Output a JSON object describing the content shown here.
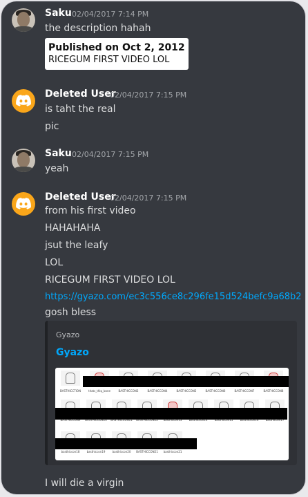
{
  "messages": [
    {
      "user": "Saku",
      "timestamp": "02/04/2017 7:14 PM",
      "lines": [
        "the description hahah"
      ],
      "quote_image": {
        "line1": "Published on Oct 2, 2012",
        "line2": "RICEGUM FIRST VIDEO LOL"
      }
    },
    {
      "user": "Deleted User",
      "timestamp": "02/04/2017 7:15 PM",
      "lines": [
        "is taht the real",
        "pic"
      ]
    },
    {
      "user": "Saku",
      "timestamp": "02/04/2017 7:15 PM",
      "lines": [
        "yeah"
      ]
    },
    {
      "user": "Deleted User",
      "timestamp": "02/04/2017 7:15 PM",
      "lines": [
        "from his first video",
        "HAHAHAHA",
        "jsut the leafy",
        "LOL",
        "RICEGUM FIRST VIDEO LOL"
      ],
      "link": "https://gyazo.com/ec3c556ce8c296fe15d524befc9a68b2",
      "after_link": "gosh bless",
      "embed": {
        "provider": "Gyazo",
        "title": "Gyazo",
        "thumb_captions": {
          "row1": [
            "BASTHICCTION",
            "thats_thiq_boner",
            "BASTHICCON3",
            "BASTHICCON4",
            "BASTHICCON5",
            "BASTHICCON6",
            "BASTHICCON7",
            "BASTHICCON8"
          ],
          "row2": [
            "BASTHICCON9",
            "BASTHICCON10",
            "BASTHICCON11",
            "BASTHICCON12",
            "basthiccon13",
            "basthiccon14",
            "basthiccon15",
            "basthiccon16",
            "basthiccon17"
          ],
          "row3": [
            "basthiccon18",
            "basthiccon19",
            "basthiccon20",
            "BASTHICCON21",
            "basthiccon21"
          ]
        }
      }
    }
  ],
  "trailing_message": "I will die a virgin",
  "colors": {
    "background": "#36393f",
    "username": "#ffffff",
    "text": "#dcddde",
    "timestamp": "#a3a6aa",
    "link": "#00a8fc",
    "deleted_user_avatar": "#faa61a",
    "embed_bg": "#2f3136"
  },
  "icons": {
    "deleted_user_avatar": "discord-logo-icon",
    "saku_avatar": "user-photo-avatar"
  }
}
